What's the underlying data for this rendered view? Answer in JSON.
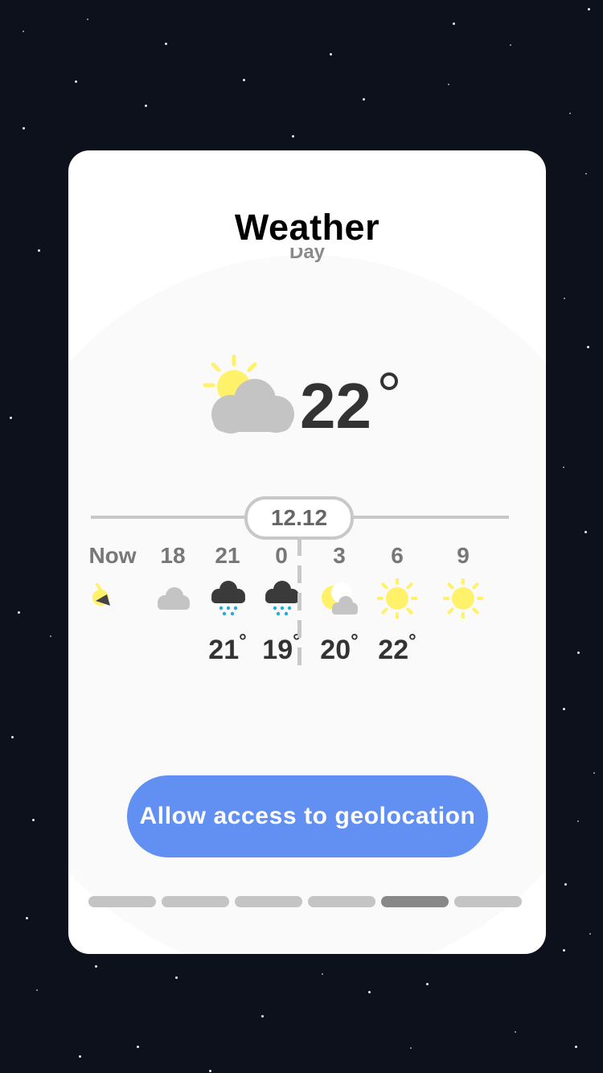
{
  "title": "Weather",
  "subtitle": "Day",
  "current": {
    "temperature": "22",
    "icon": "sun-behind-cloud-icon"
  },
  "timeline": {
    "date": "12.12"
  },
  "hourly": [
    {
      "hour": "Now",
      "icon": "sun-icon-partial",
      "temp": ""
    },
    {
      "hour": "18",
      "icon": "cloud-icon",
      "temp": ""
    },
    {
      "hour": "21",
      "icon": "snow-cloud-icon",
      "temp": "21"
    },
    {
      "hour": "0",
      "icon": "snow-cloud-icon",
      "temp": "19"
    },
    {
      "hour": "3",
      "icon": "moon-cloud-icon",
      "temp": "20"
    },
    {
      "hour": "6",
      "icon": "sun-icon",
      "temp": "22"
    },
    {
      "hour": "9",
      "icon": "sun-icon",
      "temp": ""
    }
  ],
  "degree_symbol": "°",
  "button": {
    "label": "Allow access to geolocation"
  },
  "pager": {
    "count": 6,
    "active_index": 4
  },
  "colors": {
    "background": "#0c111c",
    "card": "#ffffff",
    "button": "#6190f2",
    "sun": "#fff26a",
    "cloud_light": "#c4c4c4",
    "cloud_dark": "#3a3a3a",
    "snow": "#28a8e0",
    "pager_active": "#888888",
    "pager_inactive": "#c4c4c4"
  }
}
